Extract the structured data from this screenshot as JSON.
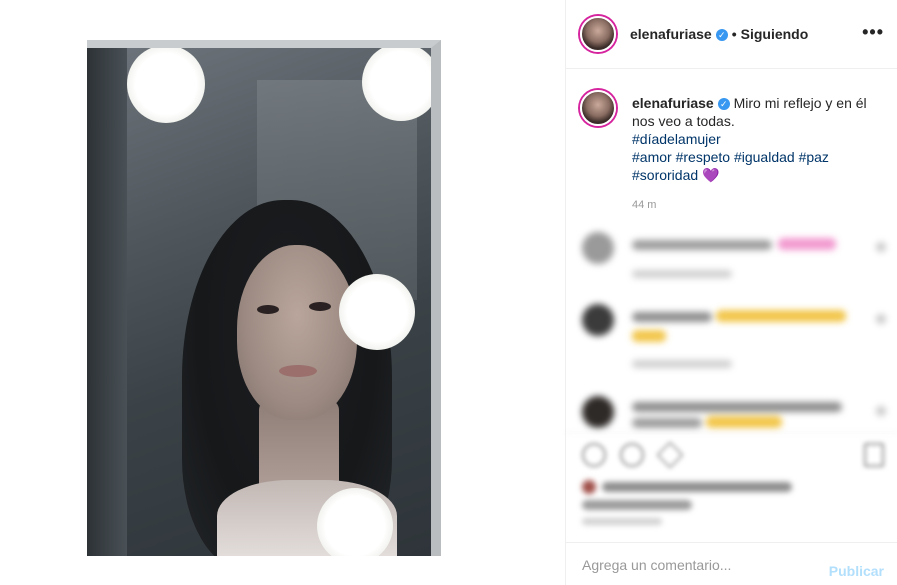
{
  "post": {
    "username": "elenafuriase",
    "verified_mark": "✓",
    "separator": "•",
    "follow_status": "Siguiendo",
    "more_icon": "•••"
  },
  "caption": {
    "username": "elenafuriase",
    "text": "Miro mi reflejo y en él nos veo a todas.",
    "hashtags": [
      "#díadelamujer",
      "#amor",
      "#respeto",
      "#igualdad",
      "#paz",
      "#sororidad"
    ],
    "emoji": "💜",
    "time": "44 m"
  },
  "composer": {
    "placeholder": "Agrega un comentario...",
    "publish_label": "Publicar"
  },
  "colors": {
    "link": "#003569",
    "verified": "#3897f0",
    "publish_disabled": "#b2dffc"
  }
}
